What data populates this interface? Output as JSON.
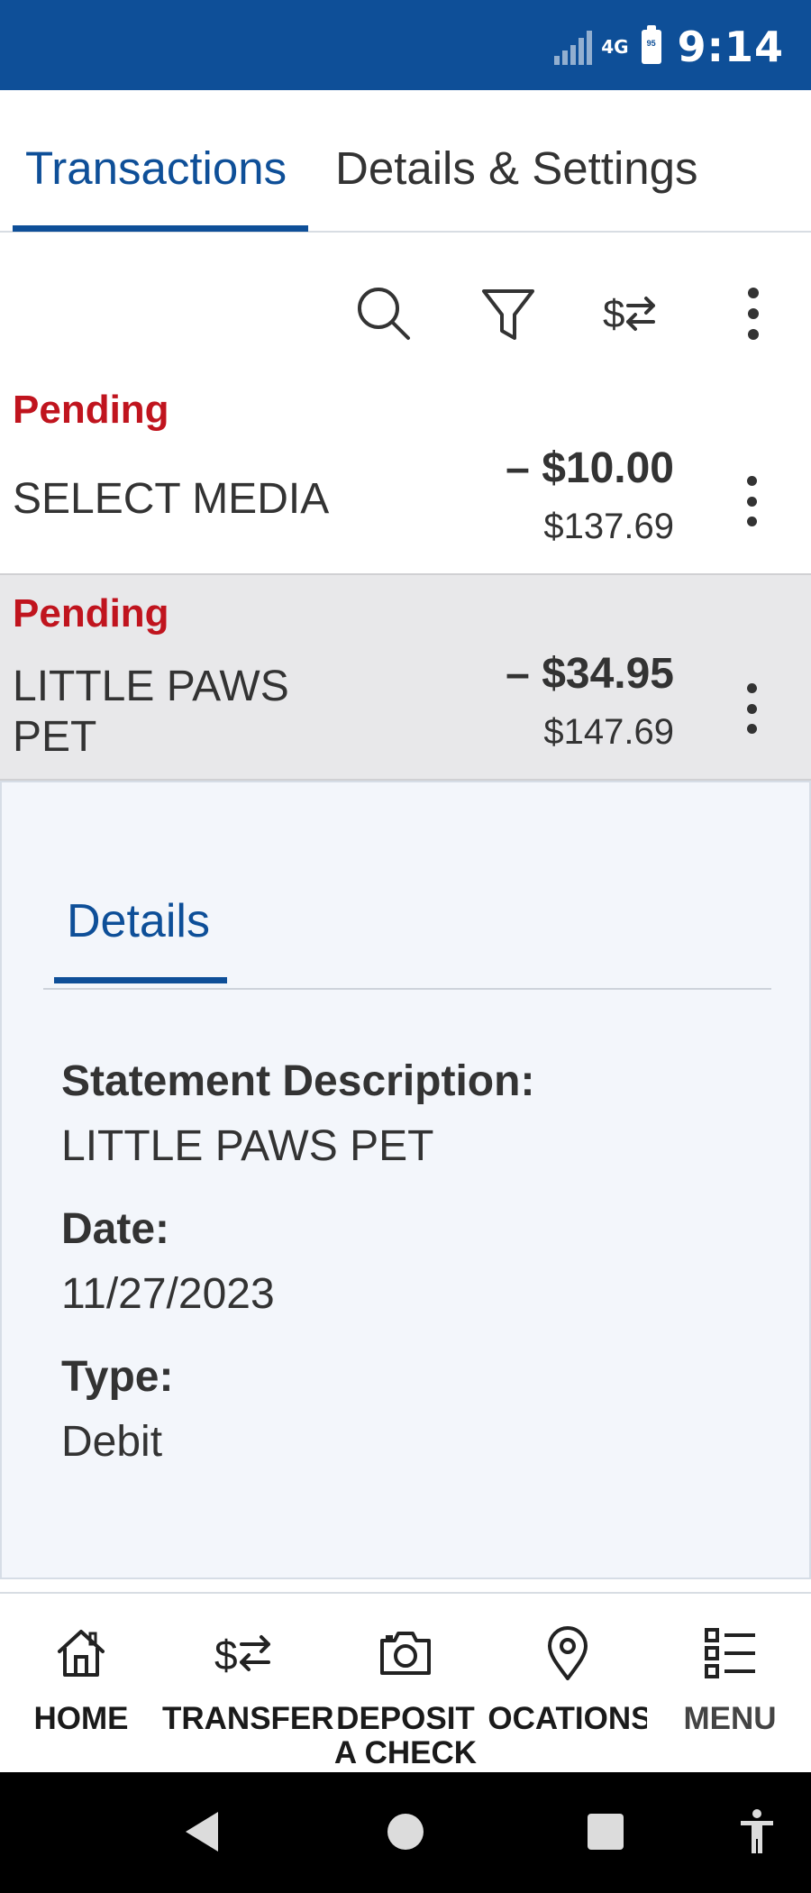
{
  "status_bar": {
    "network": "4G",
    "battery_level": "95",
    "time": "9:14",
    "background": "#0e4f98"
  },
  "tabs": [
    {
      "label": "Transactions",
      "active": true
    },
    {
      "label": "Details & Settings",
      "active": false
    }
  ],
  "toolbar": {
    "icons": [
      "search-icon",
      "filter-icon",
      "transfer-icon",
      "more-vertical-icon"
    ]
  },
  "transactions": [
    {
      "status": "Pending",
      "merchant": "SELECT MEDIA",
      "amount": "– $10.00",
      "balance": "$137.69",
      "selected": false
    },
    {
      "status": "Pending",
      "merchant": "LITTLE PAWS PET",
      "amount": "– $34.95",
      "balance": "$147.69",
      "selected": true
    }
  ],
  "details": {
    "tab_label": "Details",
    "statement_label": "Statement Description:",
    "statement_value": "LITTLE PAWS PET",
    "date_label": "Date:",
    "date_value": "11/27/2023",
    "type_label": "Type:",
    "type_value": "Debit"
  },
  "bottom_nav": {
    "home": "HOME",
    "transfer": "TRANSFER",
    "deposit": "DEPOSIT A CHECK",
    "locations": "LOCATIONS",
    "menu": "MENU"
  },
  "colors": {
    "accent": "#0e4f98",
    "pending": "#c0141e"
  }
}
